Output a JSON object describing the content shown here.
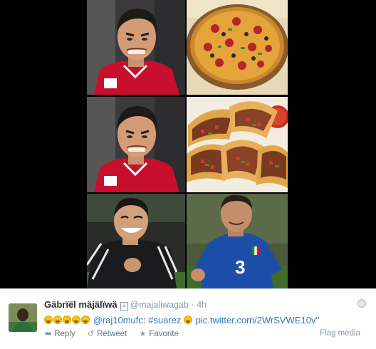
{
  "media": {
    "panels": [
      {
        "name": "player-grimace-photo-1"
      },
      {
        "name": "pizza-photo"
      },
      {
        "name": "player-grimace-photo-2"
      },
      {
        "name": "tacos-photo"
      },
      {
        "name": "player-laughing-photo"
      },
      {
        "name": "italy-player-photo"
      }
    ],
    "jersey_number": "3"
  },
  "tweet": {
    "fullname": "Gäbrïël mäjälïwä",
    "verified_glyph": "#",
    "handle": "@majaliwagab",
    "separator": "·",
    "time": "4h",
    "emoji_count": 5,
    "mention": "@raj10mufc",
    "colon": ":",
    "hashtag": "#suarez",
    "link": "pic.twitter.com/2WrSVWE10v\"",
    "actions": {
      "reply": "Reply",
      "retweet": "Retweet",
      "favorite": "Favorite"
    },
    "flag_label": "Flag media"
  },
  "colors": {
    "link": "#2b7bb9",
    "muted": "#8899a6",
    "text": "#292f33"
  }
}
